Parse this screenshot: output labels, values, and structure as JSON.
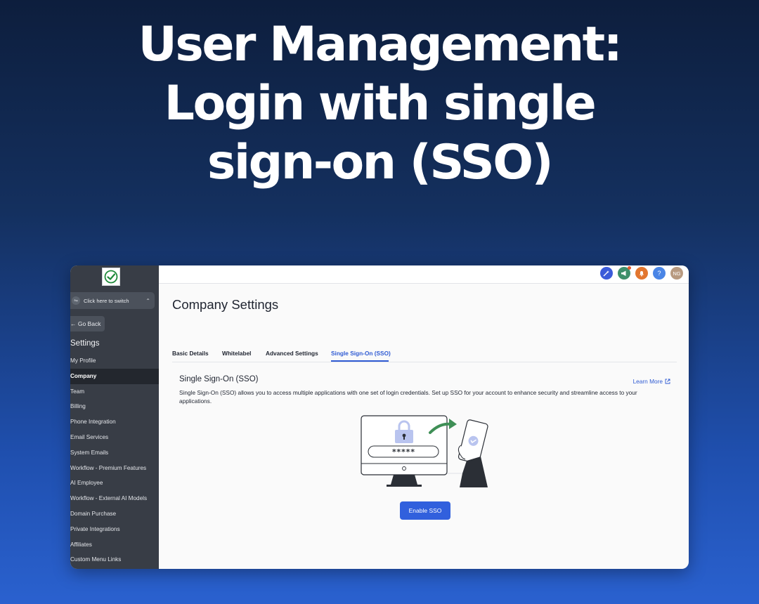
{
  "hero": {
    "line1": "User Management:",
    "line2": "Login with single",
    "line3": "sign-on (SSO)"
  },
  "sidebar": {
    "switcher_label": "Click here to switch",
    "go_back": "← Go Back",
    "settings_heading": "Settings",
    "items": [
      {
        "label": "My Profile",
        "active": false
      },
      {
        "label": "Company",
        "active": true
      },
      {
        "label": "Team",
        "active": false
      },
      {
        "label": "Billing",
        "active": false
      },
      {
        "label": "Phone Integration",
        "active": false
      },
      {
        "label": "Email Services",
        "active": false
      },
      {
        "label": "System Emails",
        "active": false
      },
      {
        "label": "Workflow - Premium Features",
        "active": false
      },
      {
        "label": "AI Employee",
        "active": false
      },
      {
        "label": "Workflow - External AI Models",
        "active": false
      },
      {
        "label": "Domain Purchase",
        "active": false
      },
      {
        "label": "Private Integrations",
        "active": false
      },
      {
        "label": "Affiliates",
        "active": false
      },
      {
        "label": "Custom Menu Links",
        "active": false
      }
    ]
  },
  "topbar": {
    "icons": [
      "magic-icon",
      "megaphone-icon",
      "bell-icon",
      "help-icon"
    ],
    "help_glyph": "?",
    "avatar_initials": "NG",
    "colors": {
      "magic": "#3b5bd9",
      "megaphone": "#3e8f6b",
      "bell": "#e2762f",
      "help": "#4a85e6",
      "avatar": "#b89a80"
    }
  },
  "main": {
    "page_title": "Company Settings",
    "tabs": [
      {
        "label": "Basic Details",
        "active": false
      },
      {
        "label": "Whitelabel",
        "active": false
      },
      {
        "label": "Advanced Settings",
        "active": false
      },
      {
        "label": "Single Sign-On (SSO)",
        "active": true
      }
    ],
    "sso_heading": "Single Sign-On (SSO)",
    "learn_more": "Learn More",
    "description": "Single Sign-On (SSO) allows you to access multiple applications with one set of login credentials. Set up SSO for your account to enhance security and streamline access to your applications.",
    "password_mask": "*****",
    "enable_button": "Enable SSO"
  },
  "colors": {
    "accent": "#3160dd",
    "sidebar_bg": "#383d46"
  }
}
